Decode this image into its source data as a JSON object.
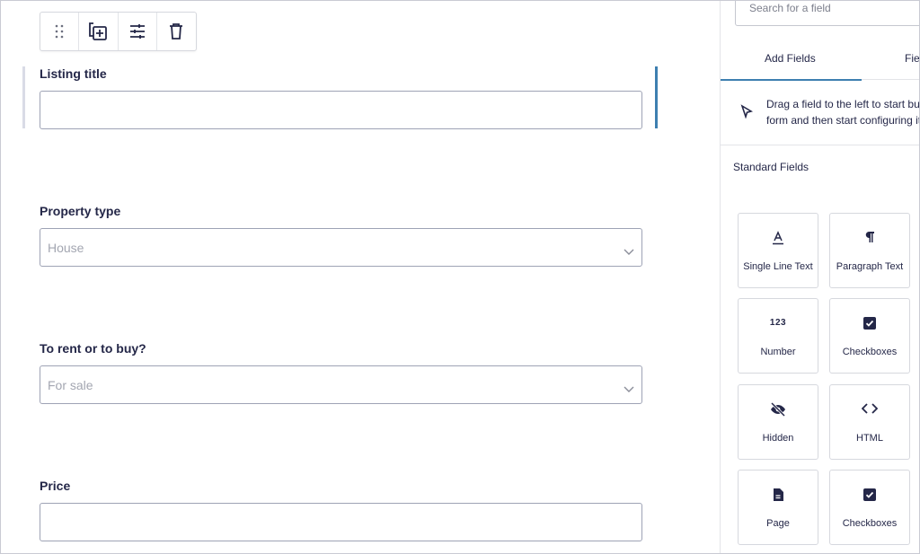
{
  "form": {
    "fields": [
      {
        "label": "Listing title",
        "value": ""
      },
      {
        "label": "Property type",
        "selected": "House"
      },
      {
        "label": "To rent or to buy?",
        "selected": "For sale"
      },
      {
        "label": "Price",
        "value": ""
      }
    ]
  },
  "sidebar": {
    "search_placeholder": "Search for a field",
    "tabs": [
      {
        "label": "Add Fields",
        "active": true
      },
      {
        "label": "Field Settings",
        "active": false
      }
    ],
    "hint_line1": "Drag a field to the left to start building your",
    "hint_line2": "form and then start configuring it.",
    "section_title": "Standard Fields",
    "tiles": [
      {
        "label": "Single Line Text",
        "icon": "text-icon"
      },
      {
        "label": "Paragraph Text",
        "icon": "pilcrow-icon"
      },
      {
        "label": "Number",
        "icon": "number-icon",
        "glyph": "123"
      },
      {
        "label": "Checkboxes",
        "icon": "checkbox-icon"
      },
      {
        "label": "Hidden",
        "icon": "eye-off-icon"
      },
      {
        "label": "HTML",
        "icon": "code-icon"
      },
      {
        "label": "Page",
        "icon": "page-icon"
      },
      {
        "label": "Checkboxes",
        "icon": "checkbox-icon"
      }
    ]
  },
  "colors": {
    "accent": "#3e7fb0",
    "text": "#242748",
    "border": "#9ea3b5"
  }
}
